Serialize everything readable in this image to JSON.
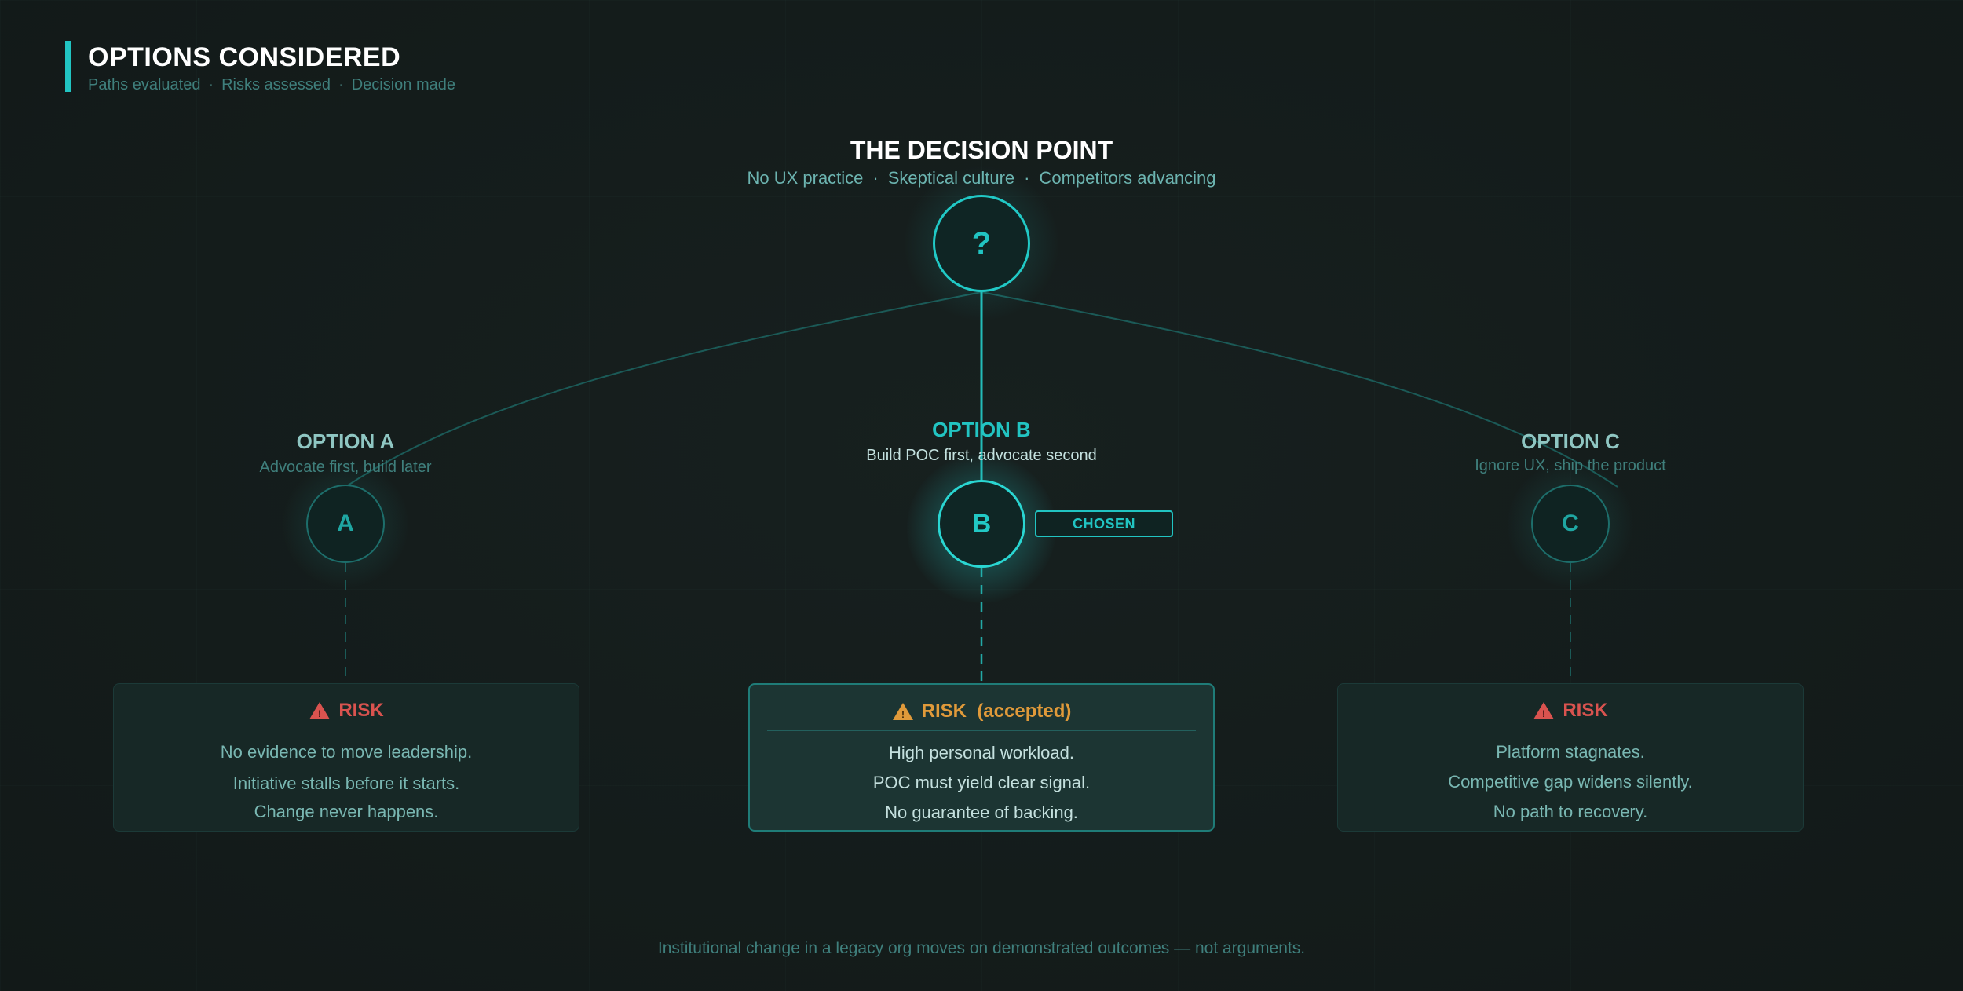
{
  "header": {
    "title": "OPTIONS CONSIDERED",
    "subtitle_parts": [
      "Paths evaluated",
      "Risks assessed",
      "Decision made"
    ],
    "separator": "·"
  },
  "decision_point": {
    "title": "THE DECISION POINT",
    "subtitle_parts": [
      "No UX practice",
      "Skeptical culture",
      "Competitors advancing"
    ],
    "separator": "·",
    "node_label": "?"
  },
  "options": [
    {
      "letter": "A",
      "title": "OPTION A",
      "subtitle": "Advocate first,  build later"
    },
    {
      "letter": "B",
      "title": "OPTION B",
      "subtitle": "Build POC first,  advocate second",
      "badge": "CHOSEN"
    },
    {
      "letter": "C",
      "title": "OPTION C",
      "subtitle": "Ignore UX,  ship the product"
    }
  ],
  "risks": [
    {
      "heading": "RISK",
      "lines": [
        "No evidence to move leadership.",
        "Initiative stalls before it starts.",
        "Change never happens."
      ]
    },
    {
      "heading": "RISK  (accepted)",
      "lines": [
        "High personal workload.",
        "POC must yield clear signal.",
        "No guarantee of backing."
      ]
    },
    {
      "heading": "RISK",
      "lines": [
        "Platform stagnates.",
        "Competitive gap widens silently.",
        "No path to recovery."
      ]
    }
  ],
  "icons": {
    "risk": "warning-triangle-icon"
  },
  "colors": {
    "accent": "#21c4c2",
    "risk_red": "#d9534f",
    "risk_amber": "#e09a3a",
    "background": "#141c1b"
  },
  "footer": "Institutional change in a legacy org moves on demonstrated outcomes — not arguments."
}
